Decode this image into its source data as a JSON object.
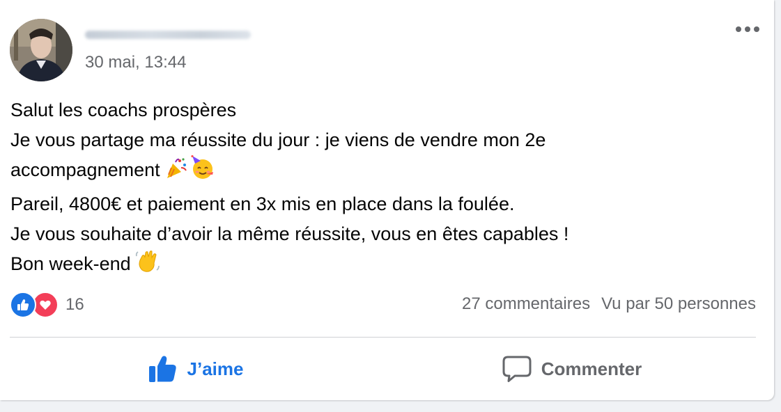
{
  "post": {
    "time": "30 mai, 13:44",
    "text_lines": [
      "Salut les coachs prospères",
      "Je vous partage ma réussite du jour : je viens de vendre mon 2e",
      "accompagnement",
      "Pareil, 4800€ et paiement en 3x mis en place dans la foulée.",
      "Je vous souhaite d’avoir la même réussite, vous en êtes capables !",
      "Bon week-end"
    ],
    "inline_emojis": [
      "party-popper-icon",
      "partying-face-icon",
      "waving-hand-icon"
    ]
  },
  "reactions": {
    "count": "16",
    "types": [
      "like",
      "love"
    ]
  },
  "stats": {
    "comments": "27 commentaires",
    "views": "Vu par 50 personnes"
  },
  "actions": {
    "like_label": "J’aime",
    "comment_label": "Commenter"
  },
  "colors": {
    "accent": "#1b74e4",
    "love": "#f33e58",
    "secondary_text": "#65676b",
    "primary_text": "#050505"
  }
}
